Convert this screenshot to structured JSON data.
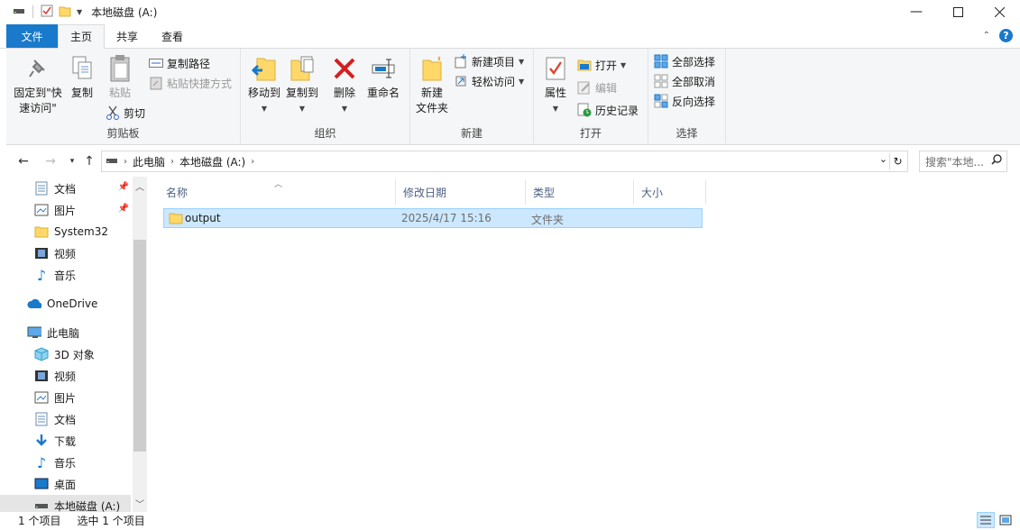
{
  "window": {
    "title": "本地磁盘 (A:)"
  },
  "tabs": {
    "file": "文件",
    "home": "主页",
    "share": "共享",
    "view": "查看"
  },
  "ribbon": {
    "clipboard": {
      "pin": "固定到\"快速访问\"",
      "copy": "复制",
      "paste": "粘贴",
      "copy_path": "复制路径",
      "paste_shortcut": "粘贴快捷方式",
      "cut": "剪切",
      "name": "剪贴板"
    },
    "organize": {
      "move_to": "移动到",
      "copy_to": "复制到",
      "delete": "删除",
      "rename": "重命名",
      "name": "组织"
    },
    "new": {
      "new_folder": "新建\n文件夹",
      "new_item": "新建项目",
      "easy_access": "轻松访问",
      "name": "新建"
    },
    "open": {
      "properties": "属性",
      "open": "打开",
      "edit": "编辑",
      "history": "历史记录",
      "name": "打开"
    },
    "select": {
      "select_all": "全部选择",
      "select_none": "全部取消",
      "invert": "反向选择",
      "name": "选择"
    }
  },
  "address": {
    "crumbs": [
      "此电脑",
      "本地磁盘 (A:)"
    ],
    "search_placeholder": "搜索\"本地..."
  },
  "sidebar": {
    "items": [
      {
        "label": "文档",
        "icon": "document-icon"
      },
      {
        "label": "图片",
        "icon": "picture-icon"
      },
      {
        "label": "System32",
        "icon": "folder-icon"
      },
      {
        "label": "视频",
        "icon": "video-icon"
      },
      {
        "label": "音乐",
        "icon": "music-icon"
      },
      {
        "label": "OneDrive",
        "icon": "cloud-icon"
      },
      {
        "label": "此电脑",
        "icon": "computer-icon"
      },
      {
        "label": "3D 对象",
        "icon": "cube-icon"
      },
      {
        "label": "视频",
        "icon": "video-icon"
      },
      {
        "label": "图片",
        "icon": "picture-icon"
      },
      {
        "label": "文档",
        "icon": "document-icon"
      },
      {
        "label": "下载",
        "icon": "download-icon"
      },
      {
        "label": "音乐",
        "icon": "music-icon"
      },
      {
        "label": "桌面",
        "icon": "desktop-icon"
      },
      {
        "label": "本地磁盘 (A:)",
        "icon": "drive-icon"
      }
    ]
  },
  "list": {
    "columns": {
      "name": "名称",
      "modified": "修改日期",
      "type": "类型",
      "size": "大小"
    },
    "rows": [
      {
        "name": "output",
        "modified": "2025/4/17 15:16",
        "type": "文件夹",
        "size": ""
      }
    ]
  },
  "status": {
    "count": "1 个项目",
    "selected": "选中 1 个项目"
  },
  "colors": {
    "accent": "#1979ca",
    "selection": "#cce8ff",
    "folder": "#ffd868"
  }
}
